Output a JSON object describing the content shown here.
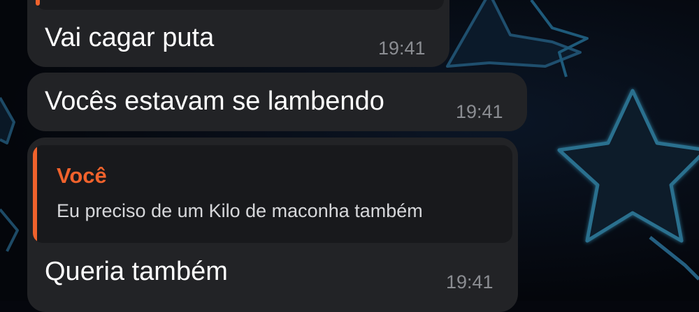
{
  "conversation": {
    "messages": [
      {
        "text": "Vai cagar puta",
        "time": "19:41"
      },
      {
        "text": "Vocês estavam se lambendo",
        "time": "19:41"
      },
      {
        "text": "Queria também",
        "time": "19:41",
        "reply": {
          "author": "Você",
          "text": "Eu preciso de um Kilo de maconha também"
        }
      }
    ]
  },
  "colors": {
    "bubble": "#222326",
    "accent": "#f0622c",
    "time": "#8b8d92",
    "background": "#05070d"
  },
  "icons": {
    "background_pattern": "star-wallpaper-icon"
  }
}
